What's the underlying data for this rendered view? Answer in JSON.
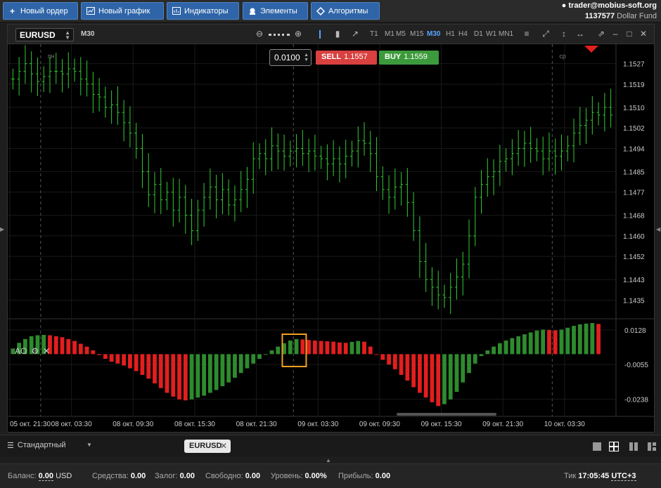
{
  "toolbar": {
    "new_order": "Новый ордер",
    "new_chart": "Новый график",
    "indicators": "Индикаторы",
    "elements": "Элементы",
    "algorithms": "Алгоритмы"
  },
  "account": {
    "email": "trader@mobius-soft.org",
    "id": "1137577",
    "fund": "Dollar Fund"
  },
  "chart": {
    "symbol": "EURUSD",
    "timeframe_label": "M30",
    "timeframes": [
      "T1",
      "M1",
      "M5",
      "M15",
      "M30",
      "H1",
      "H4",
      "D1",
      "W1",
      "MN1"
    ],
    "active_timeframe": "M30",
    "lot": "0.0100",
    "sell_label": "SELL",
    "sell_price": "1.1557",
    "buy_label": "BUY",
    "buy_price": "1.1559",
    "day_labels": [
      "пн",
      "пн",
      "ср"
    ],
    "indicator_name": "AO",
    "colors": {
      "up": "#2e8b2e",
      "down": "#e31e1e",
      "candle": "#33cc33",
      "accent": "#f0a020",
      "sell": "#d94040",
      "buy": "#3c9a3c"
    }
  },
  "chart_data": [
    {
      "type": "ohlc",
      "title": "EURUSD M30",
      "y_ticks": [
        "1.1527",
        "1.1519",
        "1.1510",
        "1.1502",
        "1.1494",
        "1.1485",
        "1.1477",
        "1.1468",
        "1.1460",
        "1.1452",
        "1.1443",
        "1.1435"
      ],
      "ylim": [
        1.1428,
        1.1534
      ],
      "x_ticks": [
        "05 окт. 21:30",
        "08 окт. 03:30",
        "08 окт. 09:30",
        "08 окт. 15:30",
        "08 окт. 21:30",
        "09 окт. 03:30",
        "09 окт. 09:30",
        "09 окт. 15:30",
        "09 окт. 21:30",
        "10 окт. 03:30"
      ],
      "close": [
        1.1521,
        1.1524,
        1.1527,
        1.1523,
        1.152,
        1.1522,
        1.1524,
        1.1524,
        1.1523,
        1.1525,
        1.1524,
        1.1521,
        1.1519,
        1.1515,
        1.1514,
        1.151,
        1.1511,
        1.1508,
        1.1504,
        1.15,
        1.1494,
        1.1485,
        1.1476,
        1.148,
        1.1474,
        1.1477,
        1.147,
        1.1475,
        1.1468,
        1.1462,
        1.147,
        1.1475,
        1.1479,
        1.1474,
        1.1478,
        1.1472,
        1.1474,
        1.1478,
        1.1482,
        1.149,
        1.1492,
        1.149,
        1.1495,
        1.1493,
        1.1491,
        1.1493,
        1.1494,
        1.1492,
        1.1493,
        1.1491,
        1.149,
        1.1488,
        1.149,
        1.1488,
        1.1491,
        1.1493,
        1.1497,
        1.1496,
        1.1492,
        1.1483,
        1.1478,
        1.1475,
        1.1479,
        1.148,
        1.1473,
        1.1462,
        1.145,
        1.1443,
        1.144,
        1.1437,
        1.1436,
        1.144,
        1.1444,
        1.1449,
        1.146,
        1.1475,
        1.148,
        1.1483,
        1.1485,
        1.1489,
        1.149,
        1.1492,
        1.1494,
        1.1496,
        1.1494,
        1.1493,
        1.149,
        1.1493,
        1.1491,
        1.1493,
        1.1495,
        1.15,
        1.1503,
        1.1505,
        1.1508,
        1.1507,
        1.151,
        1.1507
      ],
      "up_to_date": true
    },
    {
      "type": "bar",
      "title": "AO",
      "y_ticks": [
        "0.0128",
        "-0.0055",
        "-0.0238"
      ],
      "ylim": [
        -0.03,
        0.018
      ],
      "values": [
        0.003,
        0.006,
        0.008,
        0.0095,
        0.01,
        0.0102,
        0.01,
        0.0095,
        0.009,
        0.008,
        0.007,
        0.0055,
        0.004,
        0.002,
        -0.0005,
        -0.0025,
        -0.004,
        -0.005,
        -0.006,
        -0.0075,
        -0.009,
        -0.011,
        -0.013,
        -0.0155,
        -0.018,
        -0.0205,
        -0.0225,
        -0.024,
        -0.0245,
        -0.024,
        -0.023,
        -0.022,
        -0.0205,
        -0.019,
        -0.017,
        -0.015,
        -0.0125,
        -0.01,
        -0.0075,
        -0.005,
        -0.0025,
        0.0,
        0.002,
        0.004,
        0.0058,
        0.0072,
        0.008,
        0.0078,
        0.0075,
        0.0072,
        0.007,
        0.0068,
        0.0066,
        0.0062,
        0.006,
        0.0065,
        0.007,
        0.0066,
        0.004,
        0.0,
        -0.003,
        -0.0055,
        -0.008,
        -0.011,
        -0.014,
        -0.0175,
        -0.0205,
        -0.023,
        -0.0255,
        -0.0275,
        -0.0265,
        -0.024,
        -0.02,
        -0.015,
        -0.01,
        -0.005,
        -0.001,
        0.002,
        0.004,
        0.0058,
        0.0072,
        0.0085,
        0.0095,
        0.0105,
        0.0115,
        0.0125,
        0.013,
        0.0128,
        0.0126,
        0.013,
        0.014,
        0.015,
        0.0158,
        0.0162,
        0.0165,
        0.016
      ],
      "highlighted_index": 45
    }
  ],
  "tabs": {
    "layout": "Стандартный",
    "symbol_tab": "EURUSD"
  },
  "status": {
    "balance_label": "Баланс:",
    "balance": "0.00",
    "currency": "USD",
    "equity_label": "Средства:",
    "equity": "0.00",
    "margin_label": "Залог:",
    "margin": "0.00",
    "free_label": "Свободно:",
    "free": "0.00",
    "level_label": "Уровень:",
    "level": "0.00%",
    "profit_label": "Прибыль:",
    "profit": "0.00",
    "tick_label": "Тик",
    "time": "17:05:45",
    "tz": "UTC+3"
  }
}
